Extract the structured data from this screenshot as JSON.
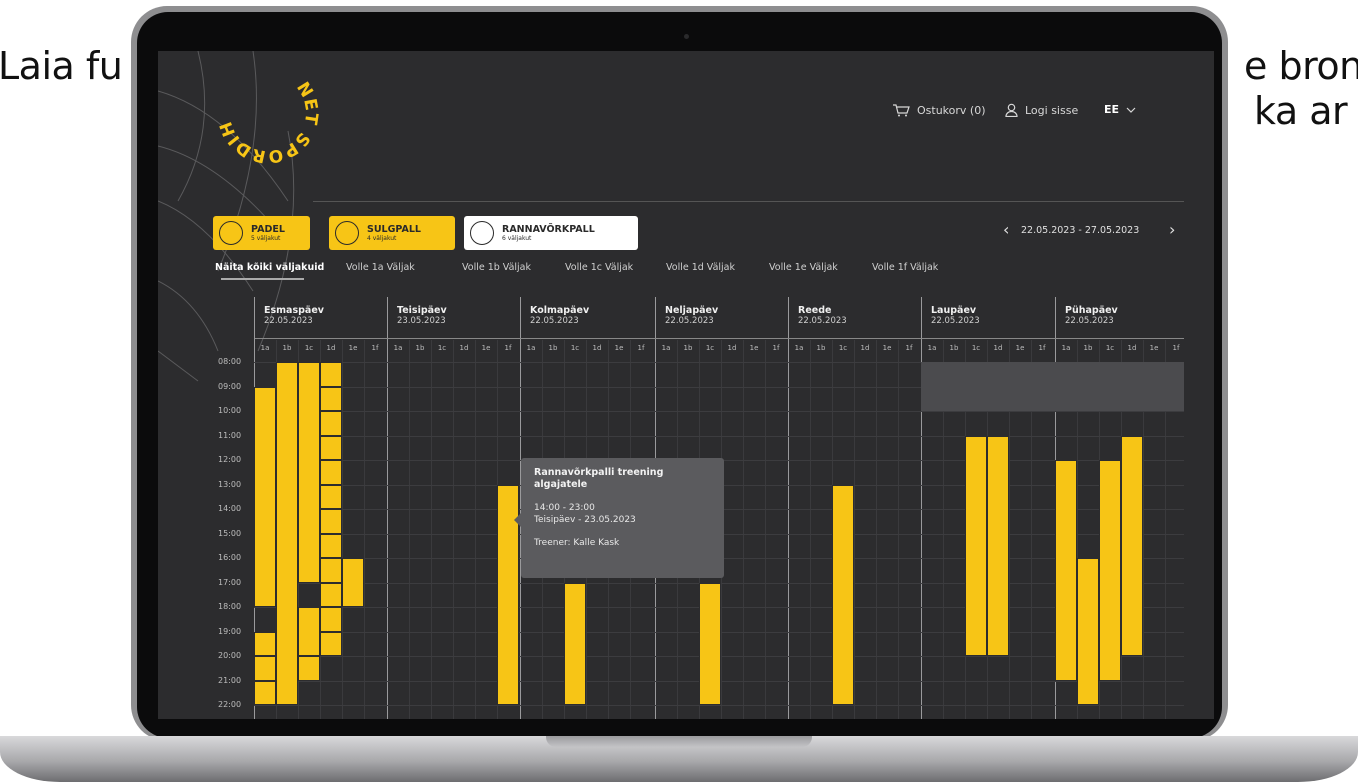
{
  "background": {
    "left_text": "Laia fu",
    "right_text_line1": "e bron",
    "right_text_line2": "ka ar"
  },
  "app": {
    "logo": {
      "text": "NET SPORDIHALL"
    },
    "header": {
      "cart_label": "Ostukorv (0)",
      "login_label": "Logi sisse",
      "language": "EE"
    },
    "sports": [
      {
        "name": "PADEL",
        "count": "5 väljakut"
      },
      {
        "name": "SULGPALL",
        "count": "4 väljakut"
      },
      {
        "name": "RANNAVÕRKPALL",
        "count": "6 väljakut"
      }
    ],
    "date_range": "22.05.2023 - 27.05.2023",
    "tabs": [
      "Näita kõiki väljakuid",
      "Volle 1a Väljak",
      "Volle 1b Väljak",
      "Volle 1c Väljak",
      "Volle 1d Väljak",
      "Volle 1e Väljak",
      "Volle 1f Väljak"
    ],
    "days": [
      {
        "name": "Esmaspäev",
        "date": "22.05.2023"
      },
      {
        "name": "Teisipäev",
        "date": "23.05.2023"
      },
      {
        "name": "Kolmapäev",
        "date": "22.05.2023"
      },
      {
        "name": "Neljapäev",
        "date": "22.05.2023"
      },
      {
        "name": "Reede",
        "date": "22.05.2023"
      },
      {
        "name": "Laupäev",
        "date": "22.05.2023"
      },
      {
        "name": "Pühapäev",
        "date": "22.05.2023"
      }
    ],
    "courts": [
      "1a",
      "1b",
      "1c",
      "1d",
      "1e",
      "1f"
    ],
    "times": [
      "08:00",
      "09:00",
      "10:00",
      "11:00",
      "12:00",
      "13:00",
      "14:00",
      "15:00",
      "16:00",
      "17:00",
      "18:00",
      "19:00",
      "20:00",
      "21:00",
      "22:00"
    ],
    "tooltip": {
      "title": "Rannavõrkpalli treening algajatele",
      "time": "14:00 - 23:00",
      "day": "Teisipäev - 23.05.2023",
      "trainer": "Treener: Kalle Kask"
    },
    "colors": {
      "accent": "#f7c516",
      "background": "#2c2c2e",
      "tooltip": "#5b5b5e"
    }
  }
}
